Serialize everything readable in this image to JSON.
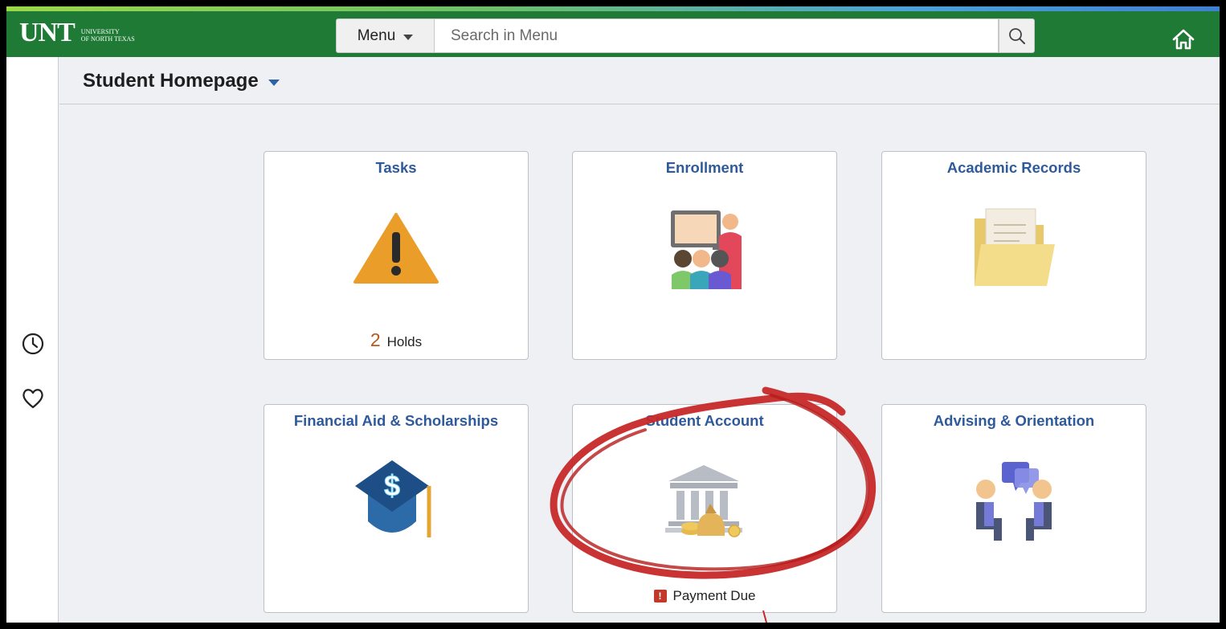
{
  "header": {
    "logo_text": "UNT",
    "logo_sub_line1": "University",
    "logo_sub_line2": "of North Texas",
    "menu_label": "Menu",
    "search_placeholder": "Search in Menu",
    "home_icon": "home-icon",
    "search_icon": "magnifier-icon"
  },
  "rail": {
    "icons": [
      "clock-icon",
      "heart-icon"
    ]
  },
  "page": {
    "title": "Student Homepage"
  },
  "tiles": [
    {
      "title": "Tasks",
      "icon": "warning-triangle-icon",
      "foot_count": "2",
      "foot_text": "Holds"
    },
    {
      "title": "Enrollment",
      "icon": "classroom-icon"
    },
    {
      "title": "Academic Records",
      "icon": "folder-icon"
    },
    {
      "title": "Financial Aid & Scholarships",
      "icon": "graduation-cap-dollar-icon"
    },
    {
      "title": "Student Account",
      "icon": "bank-moneybag-icon",
      "foot_badge": "!",
      "foot_text": "Payment Due"
    },
    {
      "title": "Advising & Orientation",
      "icon": "advising-conversation-icon"
    }
  ],
  "colors": {
    "header_green": "#1f7a35",
    "tile_title_blue": "#2e5a9c",
    "annotation_red": "#c62828"
  }
}
